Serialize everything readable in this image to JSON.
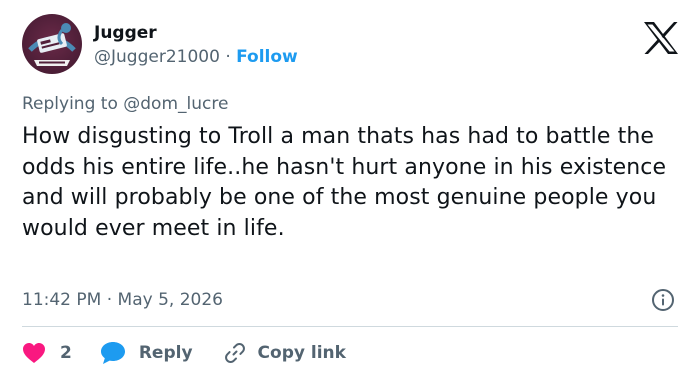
{
  "tweet": {
    "author": {
      "display_name": "Jugger",
      "handle": "@Jugger21000",
      "separator": "·",
      "follow_label": "Follow",
      "avatar_colors": [
        "#52203a",
        "#4b8bb5",
        "#ffffff"
      ]
    },
    "replying": {
      "prefix": "Replying to",
      "mention": "@dom_lucre"
    },
    "text": "How disgusting to Troll a man thats has had to battle the odds his entire life..he hasn't hurt anyone in his existence and will probably be one of the most genuine people you would ever meet in life.",
    "time": "11:42 PM",
    "date_separator": "·",
    "date": "May 5, 2026",
    "actions": {
      "like_count": "2",
      "reply_label": "Reply",
      "copy_label": "Copy link"
    },
    "colors": {
      "accent": "#1d9bf0",
      "like": "#f91880",
      "secondary_text": "#536471"
    },
    "icons": {
      "brand": "x-logo-icon",
      "info": "info-icon",
      "like": "heart-icon",
      "reply": "speech-bubble-icon",
      "copy": "link-icon"
    }
  }
}
